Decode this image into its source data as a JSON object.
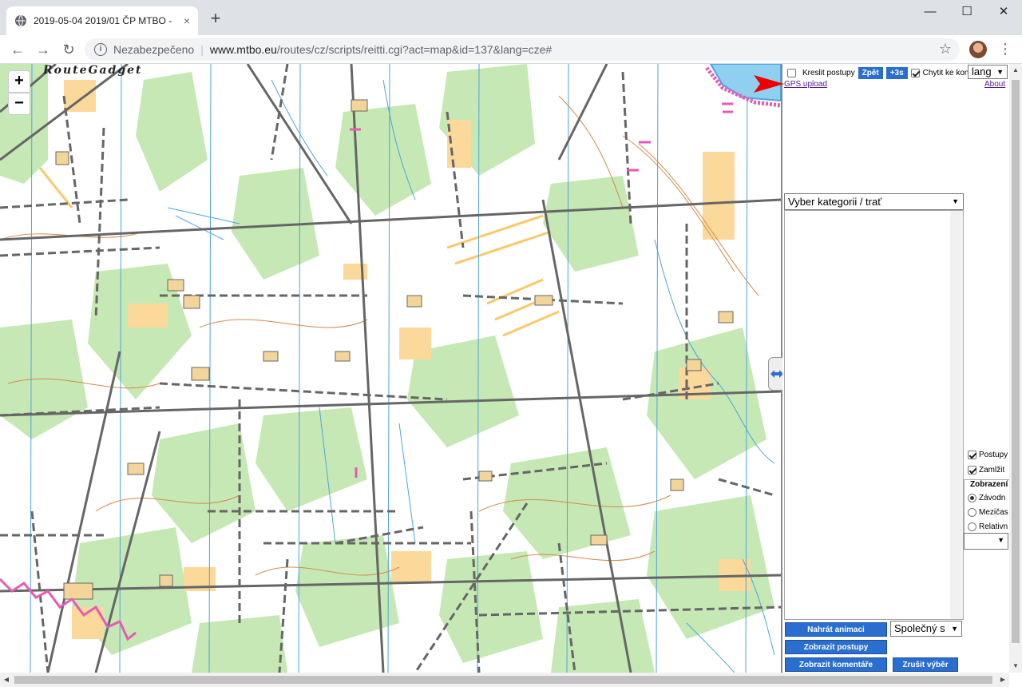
{
  "browser": {
    "tab_title": "2019-05-04 2019/01 ČP MTBO -",
    "tab_close": "×",
    "new_tab": "+",
    "win_minimize": "—",
    "win_maximize": "☐",
    "win_close": "✕",
    "back": "←",
    "forward": "→",
    "reload": "↻",
    "security_label": "Nezabezpečeno",
    "url_host": "www.mtbo.eu",
    "url_path": "/routes/cz/scripts/reitti.cgi?act=map&id=137&lang=cze#",
    "star": "☆",
    "menu": "⋮"
  },
  "map": {
    "logo": "RouteGadget",
    "zoom_in": "+",
    "zoom_out": "−"
  },
  "panel": {
    "draw_routes_label": "Kreslit postupy",
    "back_button": "Zpět",
    "plus_button": "+3s",
    "snap_label": "Chytit ke kontr",
    "lang_select": "lang",
    "gps_upload": "GPS upload",
    "about": "About",
    "category_placeholder": "Vyber kategorii / trať",
    "opt_routes": "Postupy",
    "opt_lock": "Zamlžit",
    "display_legend": "Zobrazení",
    "radio_race": "Závodn",
    "radio_split": "Mezičas",
    "radio_relative": "Relativn",
    "btn_load_animation": "Nahrát animaci",
    "mode_select": "Společný s",
    "btn_show_routes": "Zobrazit postupy",
    "btn_show_comments": "Zobrazit komentáře",
    "btn_cancel_selection": "Zrušit výběr"
  },
  "colors": {
    "accent_button": "#2a6ecf",
    "map_green": "#c5e8b4",
    "map_yellow": "#fbd99b",
    "map_track": "#666666",
    "map_water": "#4fa3e0",
    "map_contour": "#d28b4a",
    "course_magenta": "#e55bb3"
  }
}
